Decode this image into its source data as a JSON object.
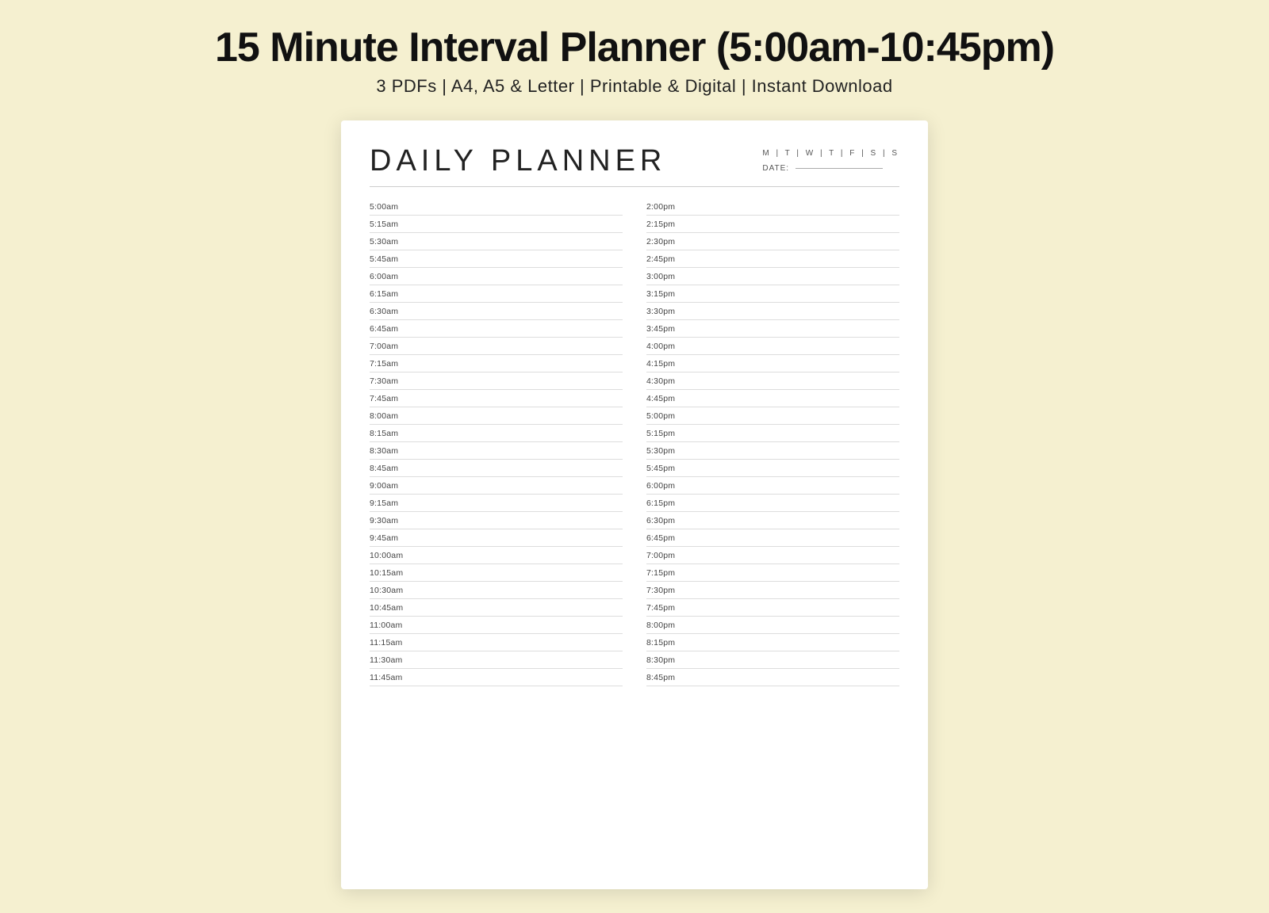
{
  "header": {
    "title": "15 Minute Interval Planner (5:00am-10:45pm)",
    "subtitle": "3 PDFs | A4, A5 & Letter | Printable & Digital | Instant Download"
  },
  "planner": {
    "title": "DAILY PLANNER",
    "days": "M | T | W | T | F | S | S",
    "date_label": "DATE:",
    "left_times": [
      "5:00am",
      "5:15am",
      "5:30am",
      "5:45am",
      "6:00am",
      "6:15am",
      "6:30am",
      "6:45am",
      "7:00am",
      "7:15am",
      "7:30am",
      "7:45am",
      "8:00am",
      "8:15am",
      "8:30am",
      "8:45am",
      "9:00am",
      "9:15am",
      "9:30am",
      "9:45am",
      "10:00am",
      "10:15am",
      "10:30am",
      "10:45am",
      "11:00am",
      "11:15am",
      "11:30am",
      "11:45am"
    ],
    "right_times": [
      "2:00pm",
      "2:15pm",
      "2:30pm",
      "2:45pm",
      "3:00pm",
      "3:15pm",
      "3:30pm",
      "3:45pm",
      "4:00pm",
      "4:15pm",
      "4:30pm",
      "4:45pm",
      "5:00pm",
      "5:15pm",
      "5:30pm",
      "5:45pm",
      "6:00pm",
      "6:15pm",
      "6:30pm",
      "6:45pm",
      "7:00pm",
      "7:15pm",
      "7:30pm",
      "7:45pm",
      "8:00pm",
      "8:15pm",
      "8:30pm",
      "8:45pm"
    ]
  }
}
